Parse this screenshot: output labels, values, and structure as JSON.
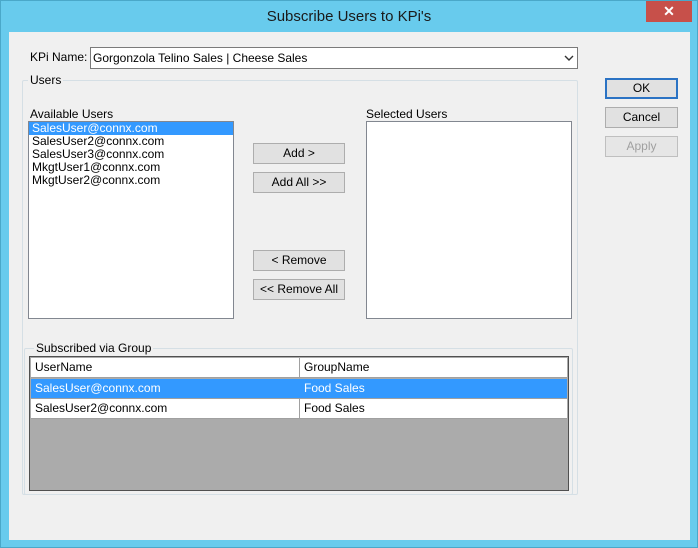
{
  "window": {
    "title": "Subscribe Users to KPi's",
    "close_glyph": "✕"
  },
  "kpi": {
    "label": "KPi Name:",
    "value": "Gorgonzola Telino Sales | Cheese Sales"
  },
  "users_group": {
    "caption": "Users"
  },
  "available_users": {
    "label": "Available Users",
    "items": [
      "SalesUser@connx.com",
      "SalesUser2@connx.com",
      "SalesUser3@connx.com",
      "MkgtUser1@connx.com",
      "MkgtUser2@connx.com"
    ],
    "selected_index": 0
  },
  "selected_users": {
    "label": "Selected Users",
    "items": []
  },
  "transfer_buttons": {
    "add": "Add >",
    "add_all": "Add All >>",
    "remove": "< Remove",
    "remove_all": "<< Remove All"
  },
  "subscribed_group": {
    "caption": "Subscribed via Group",
    "columns": [
      "UserName",
      "GroupName"
    ],
    "rows": [
      {
        "username": "SalesUser@connx.com",
        "groupname": "Food Sales",
        "selected": true
      },
      {
        "username": "SalesUser2@connx.com",
        "groupname": "Food Sales",
        "selected": false
      }
    ]
  },
  "dialog_buttons": {
    "ok": "OK",
    "cancel": "Cancel",
    "apply": "Apply"
  },
  "colors": {
    "title_bar": "#68cbed",
    "selection": "#3399ff",
    "close_button": "#c7504a"
  }
}
